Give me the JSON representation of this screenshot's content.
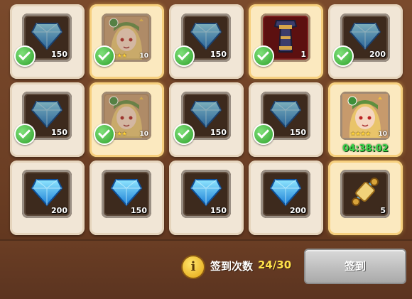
{
  "grid": {
    "cells": [
      {
        "kind": "gem",
        "qty": "150",
        "claimed": true,
        "highlight": false
      },
      {
        "kind": "hero",
        "qty": "10",
        "stars": "★★★",
        "claimed": true,
        "highlight": true
      },
      {
        "kind": "gem",
        "qty": "150",
        "claimed": true,
        "highlight": false
      },
      {
        "kind": "armor",
        "qty": "1",
        "claimed": true,
        "highlight": true
      },
      {
        "kind": "gem",
        "qty": "200",
        "claimed": true,
        "highlight": false
      },
      {
        "kind": "gem",
        "qty": "150",
        "claimed": true,
        "highlight": false
      },
      {
        "kind": "hero",
        "qty": "10",
        "stars": "★★★",
        "claimed": true,
        "highlight": true
      },
      {
        "kind": "gem",
        "qty": "150",
        "claimed": true,
        "highlight": false
      },
      {
        "kind": "gem",
        "qty": "150",
        "claimed": true,
        "highlight": false
      },
      {
        "kind": "hero",
        "qty": "10",
        "stars": "★★★★",
        "claimed": false,
        "highlight": true,
        "timer": "04:38:02"
      },
      {
        "kind": "gem",
        "qty": "200",
        "claimed": false,
        "highlight": false
      },
      {
        "kind": "gem",
        "qty": "150",
        "claimed": false,
        "highlight": false
      },
      {
        "kind": "gem",
        "qty": "150",
        "claimed": false,
        "highlight": false
      },
      {
        "kind": "gem",
        "qty": "200",
        "claimed": false,
        "highlight": false
      },
      {
        "kind": "scroll",
        "qty": "5",
        "claimed": false,
        "highlight": true
      }
    ]
  },
  "footer": {
    "info_icon": "i",
    "signin_label": "签到次数",
    "signin_count": "24/30",
    "signin_button": "签到"
  }
}
